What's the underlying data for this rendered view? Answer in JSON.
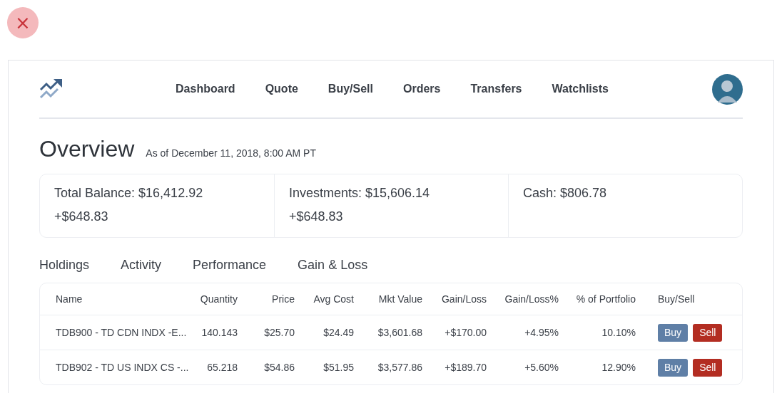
{
  "close_button": {
    "label": "×"
  },
  "nav": {
    "items": [
      {
        "label": "Dashboard"
      },
      {
        "label": "Quote"
      },
      {
        "label": "Buy/Sell"
      },
      {
        "label": "Orders"
      },
      {
        "label": "Transfers"
      },
      {
        "label": "Watchlists"
      }
    ]
  },
  "overview": {
    "title": "Overview",
    "as_of": "As of December 11, 2018, 8:00 AM PT"
  },
  "summary": [
    {
      "label": "Total Balance: $16,412.92",
      "change": "+$648.83"
    },
    {
      "label": "Investments: $15,606.14",
      "change": "+$648.83"
    },
    {
      "label": "Cash: $806.78"
    }
  ],
  "tabs": [
    {
      "label": "Holdings"
    },
    {
      "label": "Activity"
    },
    {
      "label": "Performance"
    },
    {
      "label": "Gain & Loss"
    }
  ],
  "table": {
    "columns": [
      "Name",
      "Quantity",
      "Price",
      "Avg Cost",
      "Mkt Value",
      "Gain/Loss",
      "Gain/Loss%",
      "% of Portfolio",
      "Buy/Sell"
    ],
    "rows": [
      {
        "cells": [
          "TDB900 - TD CDN INDX -E...",
          "140.143",
          "$25.70",
          "$24.49",
          "$3,601.68",
          "+$170.00",
          "+4.95%",
          "10.10%"
        ],
        "buy": "Buy",
        "sell": "Sell"
      },
      {
        "cells": [
          "TDB902 - TD US INDX CS -...",
          "65.218",
          "$54.86",
          "$51.95",
          "$3,577.86",
          "+$189.70",
          "+5.60%",
          "12.90%"
        ],
        "buy": "Buy",
        "sell": "Sell"
      }
    ]
  }
}
